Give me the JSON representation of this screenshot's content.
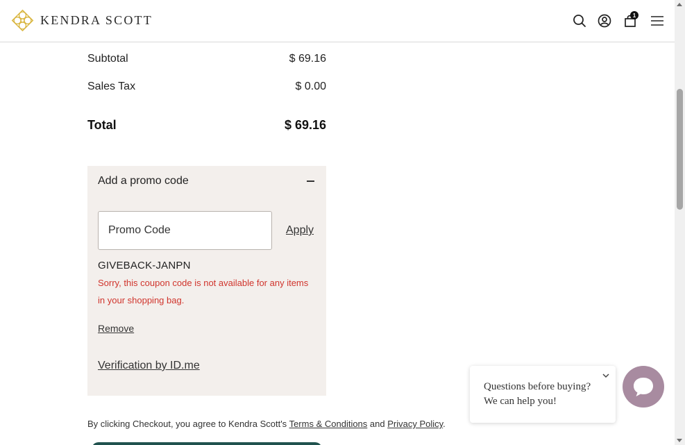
{
  "header": {
    "brand": "KENDRA SCOTT",
    "cart_count": "1",
    "icons": [
      "search-icon",
      "account-icon",
      "cart-icon",
      "menu-icon"
    ]
  },
  "summary": {
    "subtotal_label": "Subtotal",
    "subtotal_value": "$ 69.16",
    "tax_label": "Sales Tax",
    "tax_value": "$ 0.00",
    "total_label": "Total",
    "total_value": "$ 69.16"
  },
  "promo": {
    "heading": "Add a promo code",
    "placeholder": "Promo Code",
    "apply_label": "Apply",
    "applied_code": "GIVEBACK-JANPN",
    "error_message": "Sorry, this coupon code is not available for any items in your shopping bag.",
    "remove_label": "Remove",
    "verification_label": "Verification by ID.me"
  },
  "terms": {
    "prefix": "By clicking Checkout, you agree to Kendra Scott's ",
    "terms_link": "Terms & Conditions",
    "middle": " and ",
    "privacy_link": "Privacy Policy",
    "suffix": "."
  },
  "chat": {
    "line1": "Questions before buying?",
    "line2": "We can help you!"
  },
  "colors": {
    "accent": "#d9b640",
    "error": "#d0342c",
    "promo_bg": "#f3efec",
    "checkout": "#20524e",
    "chat": "#a88ba0"
  }
}
